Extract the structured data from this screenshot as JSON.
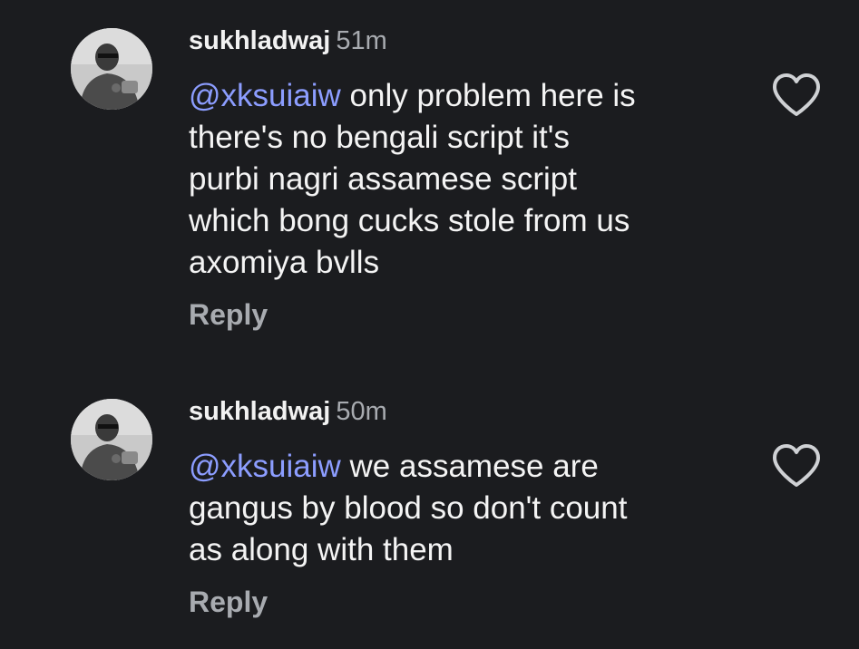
{
  "comments": [
    {
      "username": "sukhladwaj",
      "time": "51m",
      "mention": "@xksuiaiw",
      "text": " only problem here is\nthere's no bengali script it's\npurbi nagri assamese script\nwhich bong cucks stole from us\naxomiya bvlls",
      "reply_label": "Reply",
      "like_icon": "heart-outline-icon"
    },
    {
      "username": "sukhladwaj",
      "time": "50m",
      "mention": "@xksuiaiw",
      "text": " we assamese are\ngangus by blood so don't count\nas along with them",
      "reply_label": "Reply",
      "like_icon": "heart-outline-icon"
    }
  ],
  "colors": {
    "background": "#1b1c1f",
    "mention": "#8c9dff",
    "secondary_text": "#a8abb0"
  }
}
